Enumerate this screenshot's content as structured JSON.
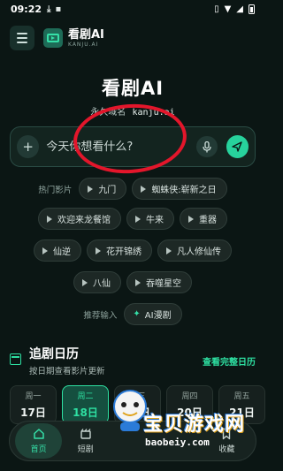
{
  "status_bar": {
    "time": "09:22"
  },
  "header": {
    "app_name": "看剧AI",
    "app_sub": "KANJU.AI"
  },
  "hero": {
    "title": "看剧AI",
    "domain_label": "永久域名",
    "domain": "kanju.ai"
  },
  "search": {
    "placeholder": "今天你想看什么?"
  },
  "hot_row_label": "热门影片",
  "hot_tags": [
    {
      "label": "九门"
    },
    {
      "label": "蜘蛛侠:崭新之日"
    },
    {
      "label": "欢迎来龙餐馆"
    },
    {
      "label": "牛来"
    },
    {
      "label": "重器"
    },
    {
      "label": "仙逆"
    },
    {
      "label": "花开锦绣"
    },
    {
      "label": "凡人修仙传"
    },
    {
      "label": "八仙"
    },
    {
      "label": "吞噬星空"
    }
  ],
  "recommend": {
    "label": "推荐输入",
    "tag": "AI漫剧"
  },
  "calendar": {
    "title": "追剧日历",
    "subtitle": "按日期查看影片更新",
    "view_all": "查看完整日历",
    "days": [
      {
        "name": "周一",
        "date": "17日",
        "active": false
      },
      {
        "name": "周二",
        "date": "18日",
        "active": true
      },
      {
        "name": "周三",
        "date": "19日",
        "active": false
      },
      {
        "name": "周四",
        "date": "20日",
        "active": false
      },
      {
        "name": "周五",
        "date": "21日",
        "active": false
      }
    ]
  },
  "tabbar": {
    "items": [
      {
        "label": "首页",
        "icon": "home-icon",
        "active": true
      },
      {
        "label": "短剧",
        "icon": "film-icon",
        "active": false
      },
      {
        "label": "",
        "icon": "",
        "active": false
      },
      {
        "label": "",
        "icon": "",
        "active": false
      },
      {
        "label": "收藏",
        "icon": "bookmark-icon",
        "active": false
      }
    ]
  },
  "watermark": {
    "text": "宝贝游戏网",
    "url": "baobeiy.com"
  },
  "colors": {
    "accent": "#2ee0a2",
    "background": "#0b1614",
    "annotation": "#e3162b"
  }
}
